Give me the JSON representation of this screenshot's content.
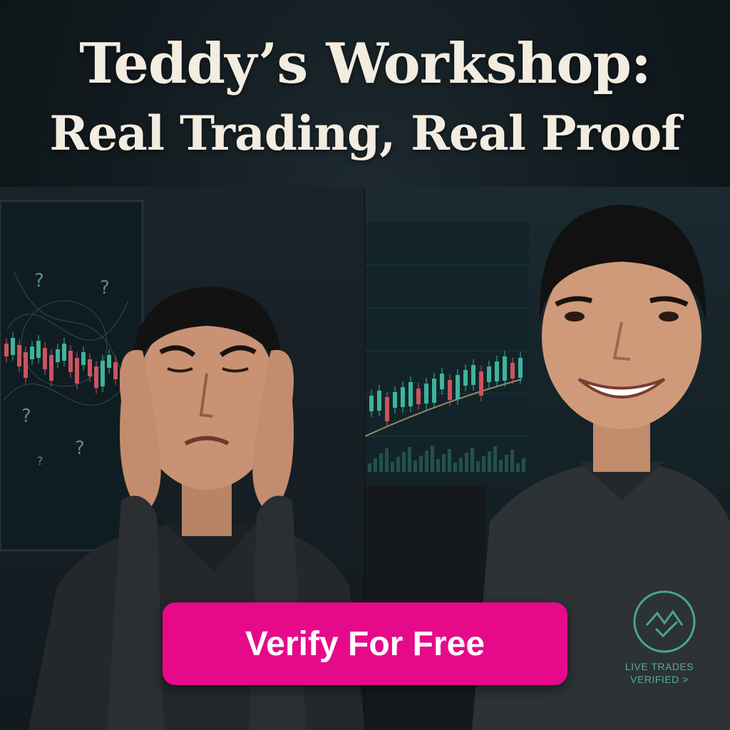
{
  "headline": {
    "line1": "Teddy’s Workshop:",
    "line2": "Real Trading, Real Proof"
  },
  "cta": {
    "label": "Verify For Free",
    "color": "#e6098a"
  },
  "badge": {
    "line1": "LIVE TRADES",
    "line2": "VERIFIED >",
    "color": "#5fc3b3",
    "icon": "check-wave-icon"
  },
  "scene": {
    "left": "confused trader with hands on face, chaotic candlestick chart with question marks",
    "right": "smiling trader, upward trending candlestick chart"
  },
  "colors": {
    "up_candle": "#3fb39a",
    "down_candle": "#c9545f"
  }
}
